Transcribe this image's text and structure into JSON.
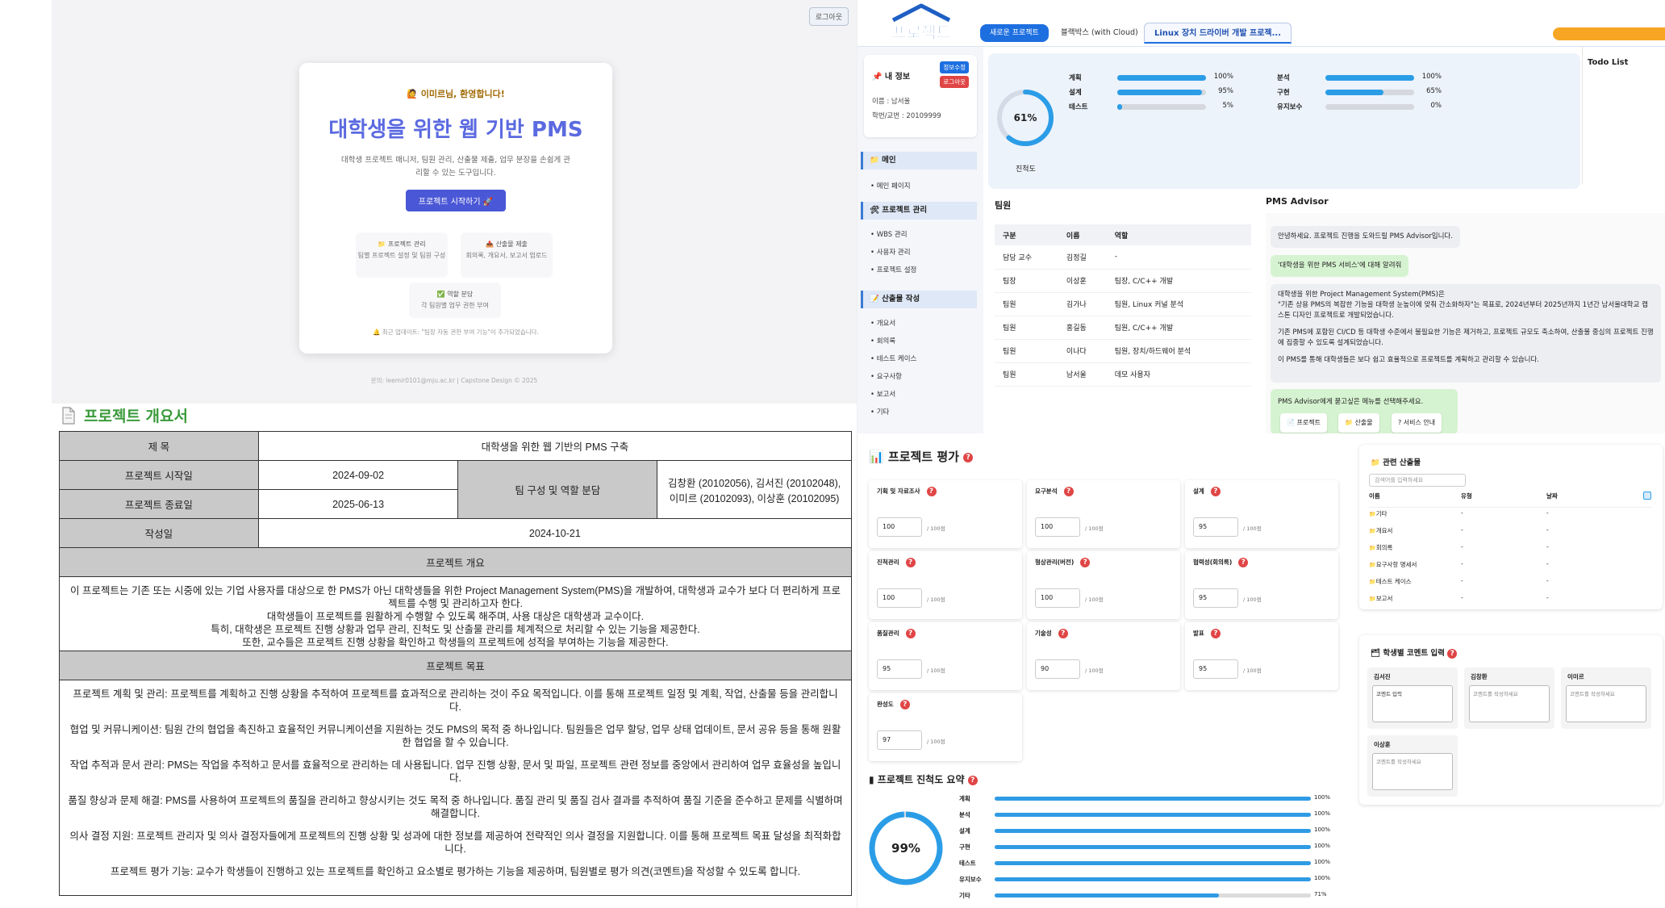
{
  "landing": {
    "logout": "로그아웃",
    "welcome": "🙋 이미르님, 환영합니다!",
    "title": "대학생을 위한 웹 기반 PMS",
    "description": "대학생 프로젝트 매니저, 팀원 관리, 산출물 제출, 업무 분장을 손쉽게 관리할 수 있는 도구입니다.",
    "start_button": "프로젝트 시작하기 🚀",
    "features": [
      {
        "title": "📁 프로젝트 관리",
        "desc": "팀별 프로젝트 설정 및 팀원 구성"
      },
      {
        "title": "📤 산출물 제출",
        "desc": "회의록, 개요서, 보고서 업로드"
      },
      {
        "title": "✅ 역할 분담",
        "desc": "각 팀원별 업무 권한 부여"
      }
    ],
    "update_note": "🔔 최근 업데이트: \"팀장 자동 권한 부여 기능\"이 추가되었습니다.",
    "footer": "문의: leemir0101@mju.ac.kr | Capstone Design © 2025"
  },
  "dashboard": {
    "logo_text": "프로젝트",
    "tabs": [
      "새로운 프로젝트",
      "블랙박스 (with Cloud)",
      "Linux 장치 드라이버 개발 프로젝..."
    ],
    "my_info": {
      "title": "📌 내 정보",
      "name": "이름 : 남서울",
      "id": "학번/교번 : 20109999",
      "edit_btn": "정보수정",
      "logout_btn": "로그아웃"
    },
    "menu": [
      {
        "title": "📁 메인",
        "items": [
          "메인 페이지"
        ]
      },
      {
        "title": "🛠 프로젝트 관리",
        "items": [
          "WBS 관리",
          "사용자 관리",
          "프로젝트 설정"
        ]
      },
      {
        "title": "📝 산출물 작성",
        "items": [
          "개요서",
          "회의록",
          "테스트 케이스",
          "요구사항",
          "보고서",
          "기타"
        ]
      }
    ],
    "progress": {
      "overall": 61,
      "overall_label": "61%",
      "caption": "진척도",
      "left": [
        {
          "label": "계획",
          "value": 100,
          "text": "100%"
        },
        {
          "label": "설계",
          "value": 95,
          "text": "95%"
        },
        {
          "label": "테스트",
          "value": 5,
          "text": "5%"
        }
      ],
      "right": [
        {
          "label": "분석",
          "value": 100,
          "text": "100%"
        },
        {
          "label": "구현",
          "value": 65,
          "text": "65%"
        },
        {
          "label": "유지보수",
          "value": 0,
          "text": "0%"
        }
      ]
    },
    "todo_title": "Todo List",
    "team": {
      "title": "팀원",
      "headers": [
        "구분",
        "이름",
        "역할"
      ],
      "rows": [
        [
          "담당 교수",
          "김정길",
          "-"
        ],
        [
          "팀장",
          "이상훈",
          "팀장, C/C++ 개발"
        ],
        [
          "팀원",
          "김가나",
          "팀원, Linux 커널 분석"
        ],
        [
          "팀원",
          "홍길동",
          "팀원, C/C++ 개발"
        ],
        [
          "팀원",
          "이나다",
          "팀원, 장치/하드웨어 분석"
        ],
        [
          "팀원",
          "남서울",
          "데모 사용자"
        ]
      ]
    },
    "advisor": {
      "title": "PMS Advisor",
      "greeting": "안녕하세요. 프로젝트 진행을 도와드릴 PMS Advisor입니다.",
      "user_msg": "'대학생을 위한 PMS 서비스'에 대해 알려줘",
      "answer_1": "대학생을 위한 Project Management System(PMS)은",
      "answer_2": "\"기존 상용 PMS의 복잡한 기능을 대학생 눈높이에 맞춰 간소화하자\"는 목표로, 2024년부터 2025년까지 1년간 남서울대학교 캡스톤 디자인 프로젝트로 개발되었습니다.",
      "answer_3": "기존 PMS에 포함된 CI/CD 등 대학생 수준에서 불필요한 기능은 제거하고, 프로젝트 규모도 축소하여, 산출물 중심의 프로젝트 진행에 집중할 수 있도록 설계되었습니다.",
      "answer_4": "이 PMS를 통해 대학생들은 보다 쉽고 효율적으로 프로젝트를 계획하고 관리할 수 있습니다.",
      "prompt": "PMS Advisor에게 묻고싶은 메뉴를 선택해주세요.",
      "chips": [
        "📄 프로젝트",
        "📁 산출물",
        "? 서비스 안내"
      ]
    }
  },
  "overview": {
    "title": "프로젝트 개요서",
    "labels": {
      "subject": "제 목",
      "start": "프로젝트 시작일",
      "end": "프로젝트 종료일",
      "written": "작성일",
      "team": "팀 구성 및 역할 분담",
      "summary": "프로젝트 개요",
      "goals": "프로젝트 목표"
    },
    "subject": "대학생을 위한 웹 기반의 PMS 구축",
    "start_date": "2024-09-02",
    "end_date": "2025-06-13",
    "written_date": "2024-10-21",
    "team_1": "김창환 (20102056), 김서진 (20102048),",
    "team_2": "이미르 (20102093), 이상훈 (20102095)",
    "summary_lines": [
      "이 프로젝트는 기존 또는 시중에 있는 기업 사용자를 대상으로 한 PMS가 아닌 대학생들을 위한 Project Management System(PMS)을 개발하여, 대학생과 교수가 보다 더 편리하게 프로젝트를 수행 및 관리하고자 한다.",
      "대학생들이 프로젝트를 원활하게 수행할 수 있도록 해주며, 사용 대상은 대학생과 교수이다.",
      "특히, 대학생은 프로젝트 진행 상황과 업무 관리, 진척도 및 산출물 관리를 체계적으로 처리할 수 있는 기능을 제공한다.",
      "또한, 교수들은 프로젝트 진행 상황을 확인하고 학생들의 프로젝트에 성적을 부여하는 기능을 제공한다."
    ],
    "goal_lines": [
      "프로젝트 계획 및 관리: 프로젝트를 계획하고 진행 상황을 추적하여 프로젝트를 효과적으로 관리하는 것이 주요 목적입니다. 이를 통해 프로젝트 일정 및 계획, 작업, 산출물 등을 관리합니다.",
      "협업 및 커뮤니케이션: 팀원 간의 협업을 촉진하고 효율적인 커뮤니케이션을 지원하는 것도 PMS의 목적 중 하나입니다. 팀원들은 업무 할당, 업무 상태 업데이트, 문서 공유 등을 통해 원활한 협업을 할 수 있습니다.",
      "작업 추적과 문서 관리: PMS는 작업을 추적하고 문서를 효율적으로 관리하는 데 사용됩니다. 업무 진행 상황, 문서 및 파일, 프로젝트 관련 정보를 중앙에서 관리하여 업무 효율성을 높입니다.",
      "품질 향상과 문제 해결: PMS를 사용하여 프로젝트의 품질을 관리하고 향상시키는 것도 목적 중 하나입니다. 품질 관리 및 품질 검사 결과를 추적하여 품질 기준을 준수하고 문제를 식별하며 해결합니다.",
      "의사 결정 지원: 프로젝트 관리자 및 의사 결정자들에게 프로젝트의 진행 상황 및 성과에 대한 정보를 제공하여 전략적인 의사 결정을 지원합니다. 이를 통해 프로젝트 목표 달성을 최적화합니다.",
      "프로젝트 평가 기능: 교수가 학생들이 진행하고 있는 프로젝트를 확인하고 요소별로 평가하는 기능을 제공하며, 팀원별로 평가 의견(코멘트)을 작성할 수 있도록 합니다."
    ]
  },
  "evaluation": {
    "title": "📊 프로젝트 평가",
    "max_label": "/ 100점",
    "items": [
      {
        "label": "기획 및 자료조사",
        "value": "100"
      },
      {
        "label": "요구분석",
        "value": "100"
      },
      {
        "label": "설계",
        "value": "95"
      },
      {
        "label": "진척관리",
        "value": "100"
      },
      {
        "label": "형상관리(버전)",
        "value": "100"
      },
      {
        "label": "협력성(회의록)",
        "value": "95"
      },
      {
        "label": "품질관리",
        "value": "95"
      },
      {
        "label": "기술성",
        "value": "90"
      },
      {
        "label": "발표",
        "value": "95"
      },
      {
        "label": "완성도",
        "value": "97"
      }
    ],
    "summary_title": "프로젝트 진척도 요약",
    "summary_overall": 99,
    "summary_overall_label": "99%",
    "summary": [
      {
        "label": "계획",
        "value": 100,
        "text": "100%"
      },
      {
        "label": "분석",
        "value": 100,
        "text": "100%"
      },
      {
        "label": "설계",
        "value": 100,
        "text": "100%"
      },
      {
        "label": "구현",
        "value": 100,
        "text": "100%"
      },
      {
        "label": "테스트",
        "value": 100,
        "text": "100%"
      },
      {
        "label": "유지보수",
        "value": 100,
        "text": "100%"
      },
      {
        "label": "기타",
        "value": 71,
        "text": "71%"
      }
    ],
    "artifacts": {
      "title": "📁 관련 산출물",
      "search_placeholder": "검색어를 입력하세요",
      "headers": [
        "이름",
        "유형",
        "날짜"
      ],
      "rows": [
        "기타",
        "개요서",
        "회의록",
        "요구사항 명세서",
        "테스트 케이스",
        "보고서"
      ],
      "dash": "-"
    },
    "comments": {
      "title": "🗂 학생별 코멘트 입력",
      "students": [
        {
          "name": "김서진",
          "text": "코멘트 입력"
        },
        {
          "name": "김창환",
          "text": "코멘트를 작성하세요"
        },
        {
          "name": "이미르",
          "text": "코멘트를 작성하세요"
        },
        {
          "name": "이상훈",
          "text": "코멘트를 작성하세요"
        }
      ]
    }
  },
  "colors": {
    "accent": "#4a57d6",
    "bar": "#2b9de7",
    "green": "#3a9a3a",
    "danger": "#e04545"
  }
}
